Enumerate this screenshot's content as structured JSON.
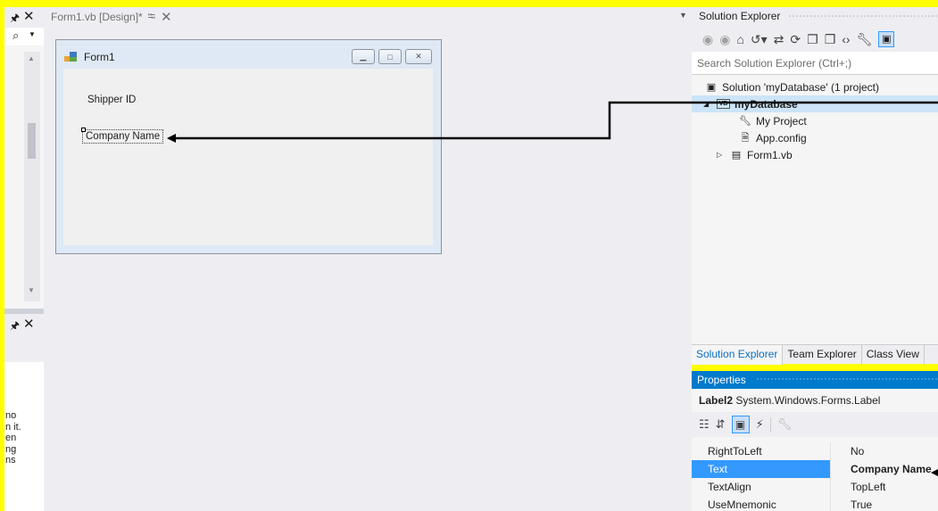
{
  "left_panel": {
    "pin_glyph": "ꟼ",
    "close_glyph": "✕",
    "search_icon": "magnifier-icon",
    "bottom_text_lines": [
      "no",
      "n it.",
      "en",
      "ng",
      "ns"
    ]
  },
  "designer": {
    "tab_label": "Form1.vb [Design]*",
    "form": {
      "title": "Form1",
      "labels": {
        "shipper_id": "Shipper ID",
        "company_name": "Company Name"
      }
    }
  },
  "solution_explorer": {
    "title": "Solution Explorer",
    "search_placeholder": "Search Solution Explorer (Ctrl+;)",
    "tree": {
      "solution": "Solution 'myDatabase' (1 project)",
      "project": "myDatabase",
      "items": [
        "My Project",
        "App.config",
        "Form1.vb"
      ]
    },
    "tabs": [
      "Solution Explorer",
      "Team Explorer",
      "Class View"
    ]
  },
  "properties": {
    "title": "Properties",
    "object_name": "Label2",
    "object_type": "System.Windows.Forms.Label",
    "rows": [
      {
        "name": "RightToLeft",
        "value": "No"
      },
      {
        "name": "Text",
        "value": "Company Name"
      },
      {
        "name": "TextAlign",
        "value": "TopLeft"
      },
      {
        "name": "UseMnemonic",
        "value": "True"
      }
    ]
  },
  "colors": {
    "highlight_background": "#ffff00",
    "ide_accent": "#007acc",
    "selection": "#3399ff"
  }
}
